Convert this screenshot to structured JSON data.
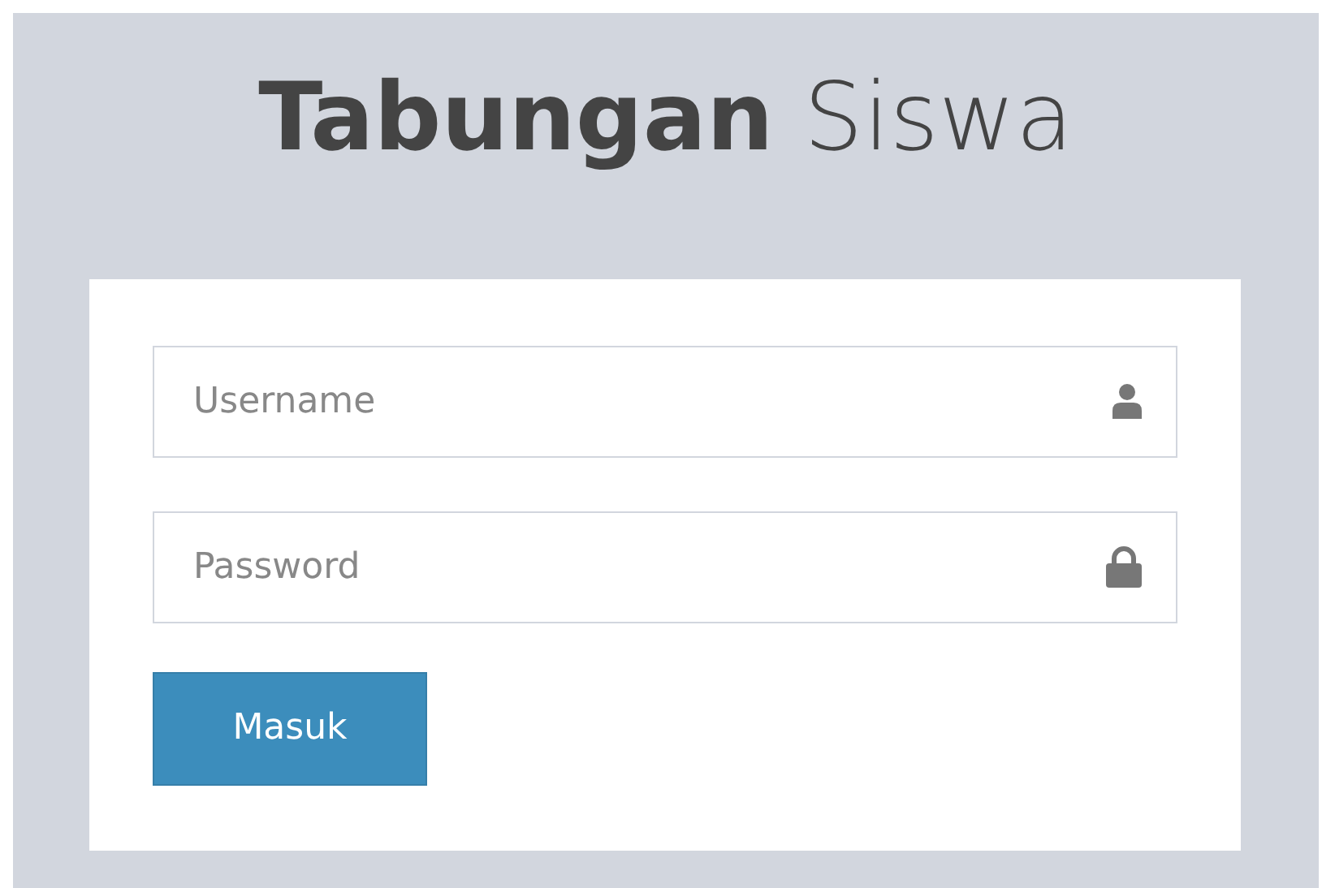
{
  "logo": {
    "text": "**Tabungan** Siswa"
  },
  "form": {
    "fields": [
      {
        "placeholder": "Username",
        "kind": "user"
      },
      {
        "placeholder": "Password",
        "kind": "password"
      }
    ],
    "submit": {
      "label": "Masuk"
    }
  }
}
